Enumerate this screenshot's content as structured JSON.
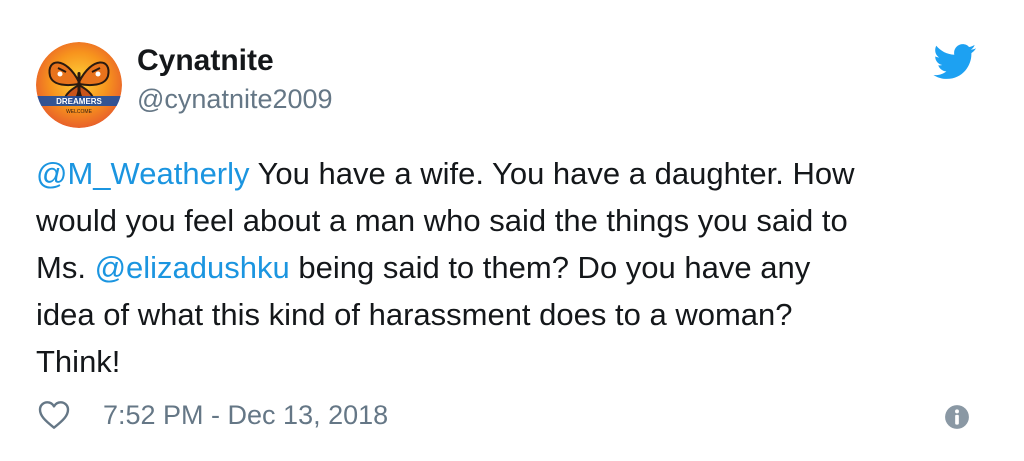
{
  "tweet": {
    "display_name": "Cynatnite",
    "handle": "@cynatnite2009",
    "avatar_text": "DREAMERS",
    "avatar_subtext": "WELCOME",
    "lines": [
      {
        "parts": [
          {
            "text": "@M_Weatherly",
            "mention": true
          },
          {
            "text": " You have a wife. You have a daughter. How",
            "mention": false
          }
        ]
      },
      {
        "parts": [
          {
            "text": "would you feel about a man who said the things you said to",
            "mention": false
          }
        ]
      },
      {
        "parts": [
          {
            "text": "Ms. ",
            "mention": false
          },
          {
            "text": "@elizadushku",
            "mention": true
          },
          {
            "text": " being said to them? Do you have any",
            "mention": false
          }
        ]
      },
      {
        "parts": [
          {
            "text": "idea of what this kind of harassment does to a woman?",
            "mention": false
          }
        ]
      },
      {
        "parts": [
          {
            "text": "Think!",
            "mention": false
          }
        ]
      }
    ],
    "timestamp": "7:52 PM - Dec 13, 2018"
  },
  "icons": {
    "brand": "twitter-bird-icon",
    "like": "heart-icon",
    "info": "info-icon"
  },
  "colors": {
    "link": "#1b95e0",
    "text": "#14171a",
    "secondary": "#657786",
    "twitter_blue": "#1da1f2"
  }
}
